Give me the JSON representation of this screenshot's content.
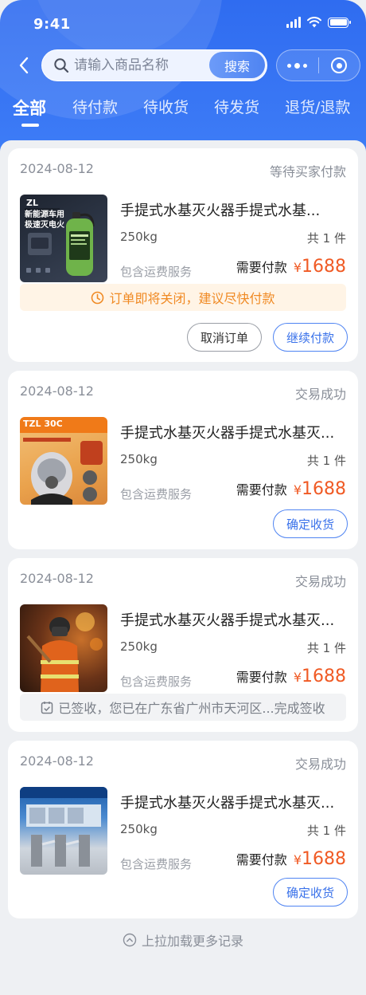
{
  "status_bar": {
    "time": "9:41"
  },
  "search": {
    "placeholder": "请输入商品名称",
    "button_label": "搜索"
  },
  "tabs": [
    {
      "label": "全部",
      "active": true
    },
    {
      "label": "待付款"
    },
    {
      "label": "待收货"
    },
    {
      "label": "待发货"
    },
    {
      "label": "退货/退款"
    }
  ],
  "orders": [
    {
      "date": "2024-08-12",
      "status": "等待买家付款",
      "product_title": "手提式水基灭火器手提式水基...",
      "spec": "250kg",
      "quantity": "共 1 件",
      "service": "包含运费服务",
      "pay_label": "需要付款",
      "currency": "¥",
      "amount": "1688",
      "notice": "订单即将关闭，建议尽快付款",
      "thumb_text": {
        "badge": "新能源车用",
        "subtitle": "极速灭电火"
      },
      "buttons": [
        "取消订单",
        "继续付款"
      ]
    },
    {
      "date": "2024-08-12",
      "status": "交易成功",
      "product_title": "手提式水基灭火器手提式水基灭...",
      "spec": "250kg",
      "quantity": "共 1 件",
      "service": "包含运费服务",
      "pay_label": "需要付款",
      "currency": "¥",
      "amount": "1688",
      "thumb_text": {
        "badge": "TZL 30C"
      },
      "buttons": [
        "确定收货"
      ]
    },
    {
      "date": "2024-08-12",
      "status": "交易成功",
      "product_title": "手提式水基灭火器手提式水基灭...",
      "spec": "250kg",
      "quantity": "共 1 件",
      "service": "包含运费服务",
      "pay_label": "需要付款",
      "currency": "¥",
      "amount": "1688",
      "notice": "已签收，您已在广东省广州市天河区...完成签收"
    },
    {
      "date": "2024-08-12",
      "status": "交易成功",
      "product_title": "手提式水基灭火器手提式水基灭...",
      "spec": "250kg",
      "quantity": "共 1 件",
      "service": "包含运费服务",
      "pay_label": "需要付款",
      "currency": "¥",
      "amount": "1688",
      "buttons": [
        "确定收货"
      ]
    }
  ],
  "footer": {
    "text": "上拉加载更多记录"
  },
  "colors": {
    "brand": "#3a78f5",
    "price": "#f05a24",
    "warn": "#f08a24"
  },
  "icons": [
    "back-icon",
    "search-icon",
    "more-icon",
    "target-icon",
    "clock-icon",
    "checklist-icon",
    "chevron-up-icon"
  ]
}
